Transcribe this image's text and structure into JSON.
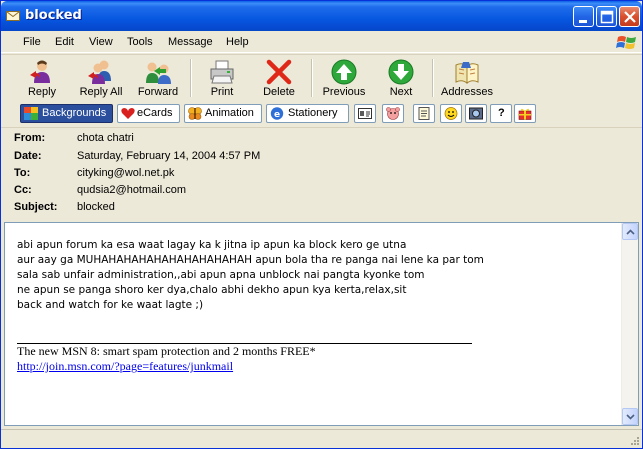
{
  "window": {
    "title": "blocked"
  },
  "menu": [
    "File",
    "Edit",
    "View",
    "Tools",
    "Message",
    "Help"
  ],
  "toolbar": {
    "reply": "Reply",
    "reply_all": "Reply All",
    "forward": "Forward",
    "print": "Print",
    "delete": "Delete",
    "previous": "Previous",
    "next": "Next",
    "addresses": "Addresses"
  },
  "stationery_bar": {
    "backgrounds": "Backgrounds",
    "ecards": "eCards",
    "animation": "Animation",
    "stationery": "Stationery"
  },
  "header": {
    "from_label": "From:",
    "from": "chota chatri",
    "date_label": "Date:",
    "date": "Saturday, February 14, 2004 4:57 PM",
    "to_label": "To:",
    "to": "cityking@wol.net.pk",
    "cc_label": "Cc:",
    "cc": "qudsia2@hotmail.com",
    "subject_label": "Subject:",
    "subject": "blocked"
  },
  "body": {
    "lines": [
      "abi apun forum ka esa waat lagay ka k jitna ip apun ka block kero ge utna",
      "aur aay ga MUHAHAHAHAHAHAHAHAHAHAH apun bola tha re panga nai lene ka par tom",
      "sala sab unfair administration,,abi apun apna unblock nai pangta kyonke tom",
      "ne apun se panga shoro ker dya,chalo abhi dekho apun kya kerta,relax,sit",
      "back and watch for ke waat lagte ;)"
    ],
    "signature_promo": "The new MSN 8: smart spam protection and 2 months FREE*",
    "signature_link": "http://join.msn.com/?page=features/junkmail"
  }
}
